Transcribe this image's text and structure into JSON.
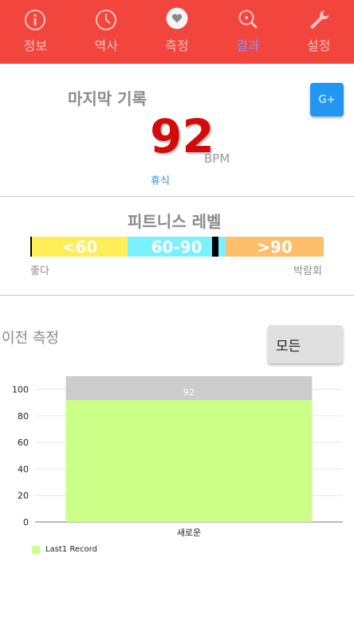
{
  "nav": {
    "items": [
      {
        "label": "정보",
        "icon": "info-icon"
      },
      {
        "label": "역사",
        "icon": "clock-icon"
      },
      {
        "label": "측정",
        "icon": "heart-icon"
      },
      {
        "label": "결과",
        "icon": "magnifier-icon"
      },
      {
        "label": "설정",
        "icon": "wrench-icon"
      }
    ],
    "active_index": 3,
    "colors": {
      "bar": "#f2453d",
      "label": "#f8c2bd",
      "active_label": "#8f8ff0"
    }
  },
  "last_record": {
    "title": "마지막 기록",
    "share_label": "G+",
    "bpm_value": "92",
    "bpm_unit": "BPM",
    "status": "휴식"
  },
  "fitness": {
    "title": "피트니스 레벨",
    "segments": [
      "<60",
      "60-90",
      ">90"
    ],
    "left_label": "좋다",
    "right_label": "박람회",
    "colors": {
      "low": "#ffee58",
      "mid": "#7af1ff",
      "high": "#ffbe6b"
    }
  },
  "previous": {
    "title": "이전 측정",
    "filter_label": "모든"
  },
  "chart_data": {
    "type": "bar",
    "categories": [
      "새로운"
    ],
    "series": [
      {
        "name": "Last1 Record",
        "values": [
          92
        ],
        "color": "#ccff88"
      }
    ],
    "data_labels": [
      "92"
    ],
    "ylim": [
      0,
      110
    ],
    "yticks": [
      0,
      20,
      40,
      60,
      80,
      100
    ],
    "grid": true,
    "legend": "bottom-left"
  }
}
